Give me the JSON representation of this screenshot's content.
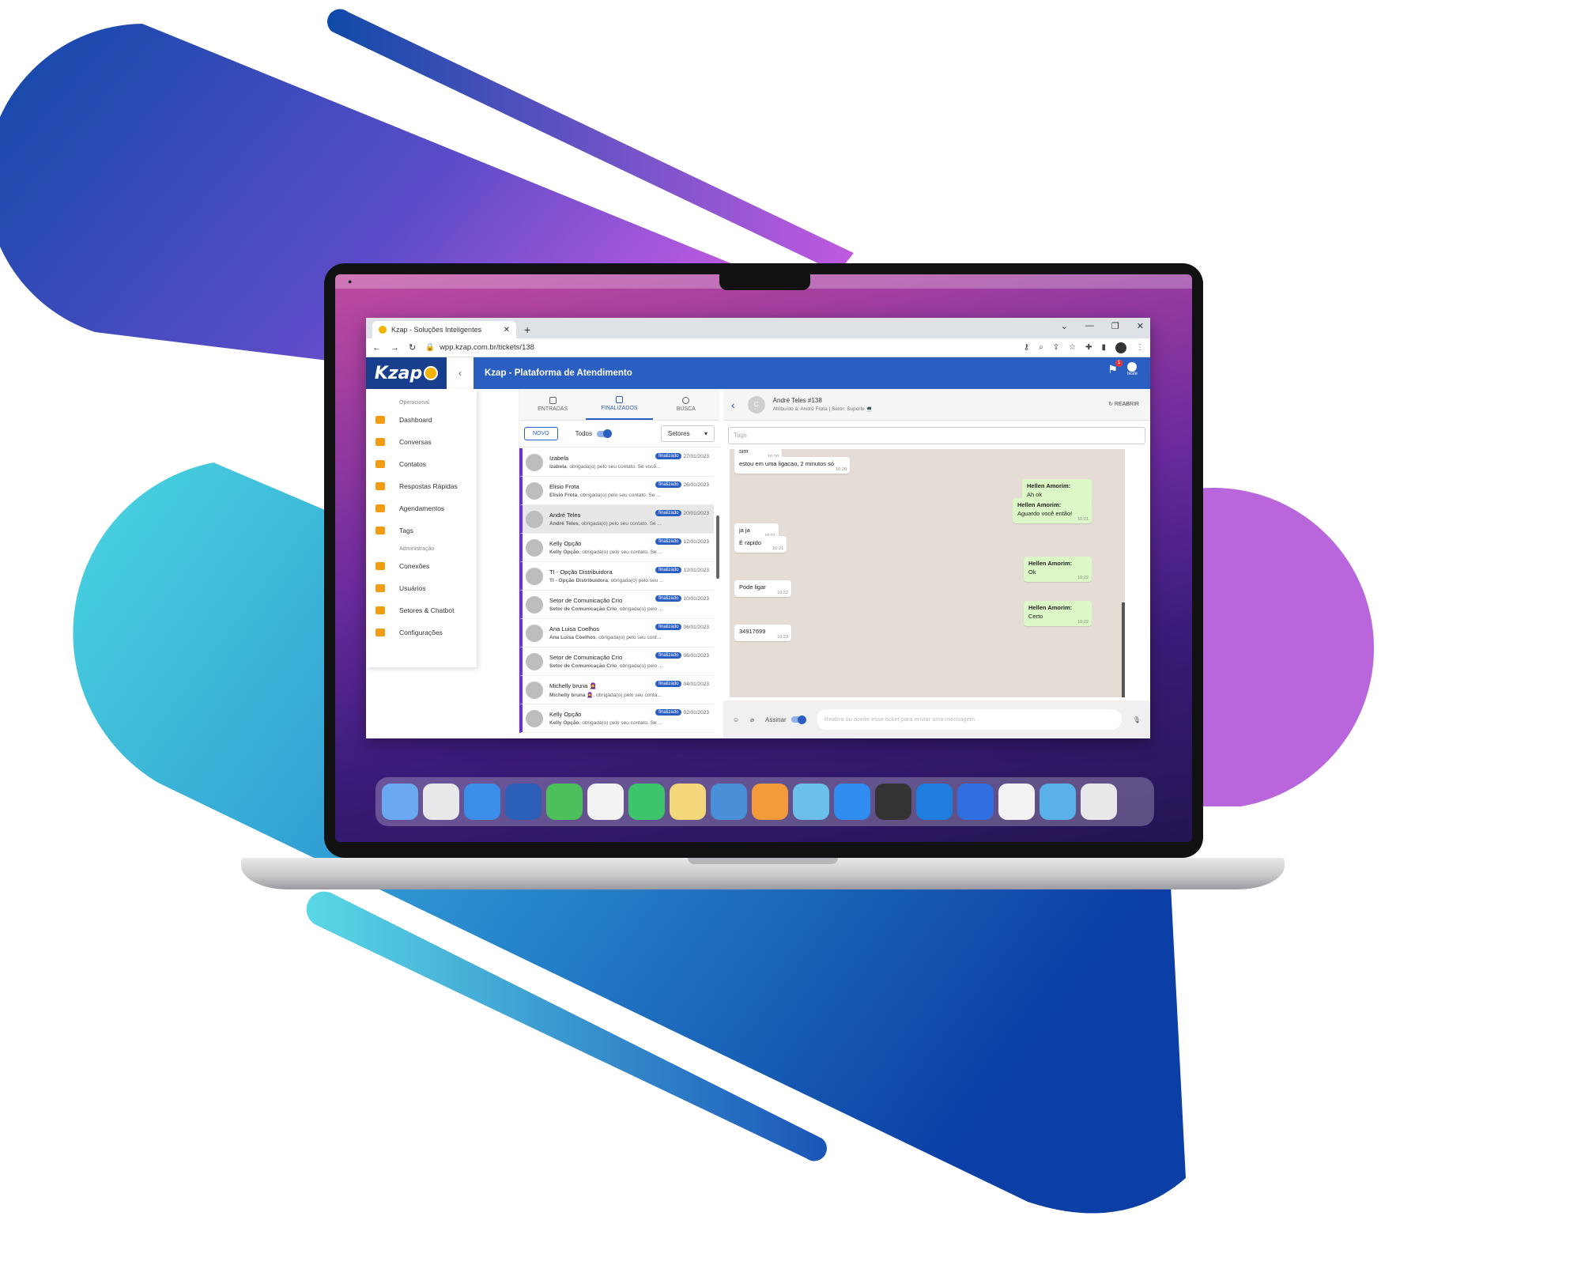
{
  "browser": {
    "tab_title": "Kzap - Soluções Inteligentes",
    "url": "wpp.kzap.com.br/tickets/138"
  },
  "header": {
    "logo": "Kzap",
    "title": "Kzap - Plataforma de Atendimento",
    "notification_count": "1",
    "user_name": "teste"
  },
  "sidebar": {
    "section_operational": "Operacional",
    "section_admin": "Administração",
    "operational_items": [
      {
        "label": "Dashboard",
        "icon": "dashboard-icon"
      },
      {
        "label": "Conversas",
        "icon": "whatsapp-icon"
      },
      {
        "label": "Contatos",
        "icon": "contacts-icon"
      },
      {
        "label": "Respostas Rápidas",
        "icon": "quick-reply-icon"
      },
      {
        "label": "Agendamentos",
        "icon": "calendar-icon"
      },
      {
        "label": "Tags",
        "icon": "tag-icon"
      }
    ],
    "admin_items": [
      {
        "label": "Conexões",
        "icon": "wifi-icon"
      },
      {
        "label": "Usuários",
        "icon": "users-icon"
      },
      {
        "label": "Setores & Chatbot",
        "icon": "sectors-icon"
      },
      {
        "label": "Configurações",
        "icon": "gear-icon"
      }
    ]
  },
  "tickets": {
    "tabs": [
      "ENTRADAS",
      "FINALIZADOS",
      "BUSCA"
    ],
    "active_tab": "FINALIZADOS",
    "new_button": "NOVO",
    "filter_all": "Todos",
    "sectors_select": "Setores",
    "status_badge": "finalizado",
    "items": [
      {
        "name": "Izabela",
        "date": "27/01/2023",
        "preview_name": "Izabela",
        "preview": "obrigada(o) pelo seu contato. Se você..."
      },
      {
        "name": "Elisio Frota",
        "date": "26/01/2023",
        "preview_name": "Elisio Frota",
        "preview": "obrigada(o) pelo seu contato. Se ..."
      },
      {
        "name": "André Teles",
        "date": "20/01/2023",
        "preview_name": "André Teles",
        "preview": "obrigada(o) pelo seu contato. Se ..."
      },
      {
        "name": "Kelly Opção",
        "date": "12/01/2023",
        "preview_name": "Kelly Opção",
        "preview": "obrigada(o) pelo seu contato. Se ..."
      },
      {
        "name": "TI - Opção Distribuidora",
        "date": "12/01/2023",
        "preview_name": "TI - Opção Distribuidora",
        "preview": "obrigada(o) pelo seu ..."
      },
      {
        "name": "Setor de Comunicação Crio",
        "date": "10/01/2023",
        "preview_name": "Setor de Comunicação Crio",
        "preview": "obrigada(o) pelo ..."
      },
      {
        "name": "Ana Luisa Coelhos",
        "date": "06/01/2023",
        "preview_name": "Ana Luisa Coelhos",
        "preview": "obrigada(o) pelo seu cont..."
      },
      {
        "name": "Setor de Comunicação Crio",
        "date": "06/01/2023",
        "preview_name": "Setor de Comunicação Crio",
        "preview": "obrigada(o) pelo ..."
      },
      {
        "name": "Michelly bruna 🧕",
        "date": "04/01/2023",
        "preview_name": "Michelly bruna 🧕",
        "preview": "obrigada(o) pelo seu conta..."
      },
      {
        "name": "Kelly Opção",
        "date": "02/01/2023",
        "preview_name": "Kelly Opção",
        "preview": "obrigada(o) pelo seu contato. Se ..."
      }
    ]
  },
  "chat": {
    "avatar_letter": "C",
    "contact": "André Teles #138",
    "subtitle": "Atribuído à: André Frota | Setor: Suporte 💻",
    "reopen_button": "REABRIR",
    "tags_placeholder": "Tags",
    "messages": [
      {
        "dir": "in",
        "author": "",
        "text": "sim",
        "time": "10:20"
      },
      {
        "dir": "in",
        "author": "",
        "text": "estou em uma ligacao, 2 minutos só",
        "time": "10:20"
      },
      {
        "dir": "out",
        "author": "Hellen Amorim:",
        "text": "Ah ok",
        "time": "10:21"
      },
      {
        "dir": "out",
        "author": "Hellen Amorim:",
        "text": "Aguardo você então!",
        "time": "10:21"
      },
      {
        "dir": "in",
        "author": "",
        "text": "ja ja",
        "time": "10:21"
      },
      {
        "dir": "in",
        "author": "",
        "text": "É rapido",
        "time": "10:21"
      },
      {
        "dir": "out",
        "author": "Hellen Amorim:",
        "text": "Ok",
        "time": "10:22"
      },
      {
        "dir": "in",
        "author": "",
        "text": "Pode ligar",
        "time": "10:22"
      },
      {
        "dir": "out",
        "author": "Hellen Amorim:",
        "text": "Certo",
        "time": "10:22"
      },
      {
        "dir": "in",
        "author": "",
        "text": "34917699",
        "time": "10:23"
      }
    ],
    "sign_label": "Assinar",
    "input_placeholder": "Reabra ou aceite esse ticket para enviar uma mensagem."
  },
  "colors": {
    "primary": "#2a5fc1",
    "logo_bg": "#183f8e",
    "ticket_accent": "#6a2ee8",
    "outgoing_bubble": "#dcf8c6",
    "chat_bg": "#e5ddd5"
  }
}
